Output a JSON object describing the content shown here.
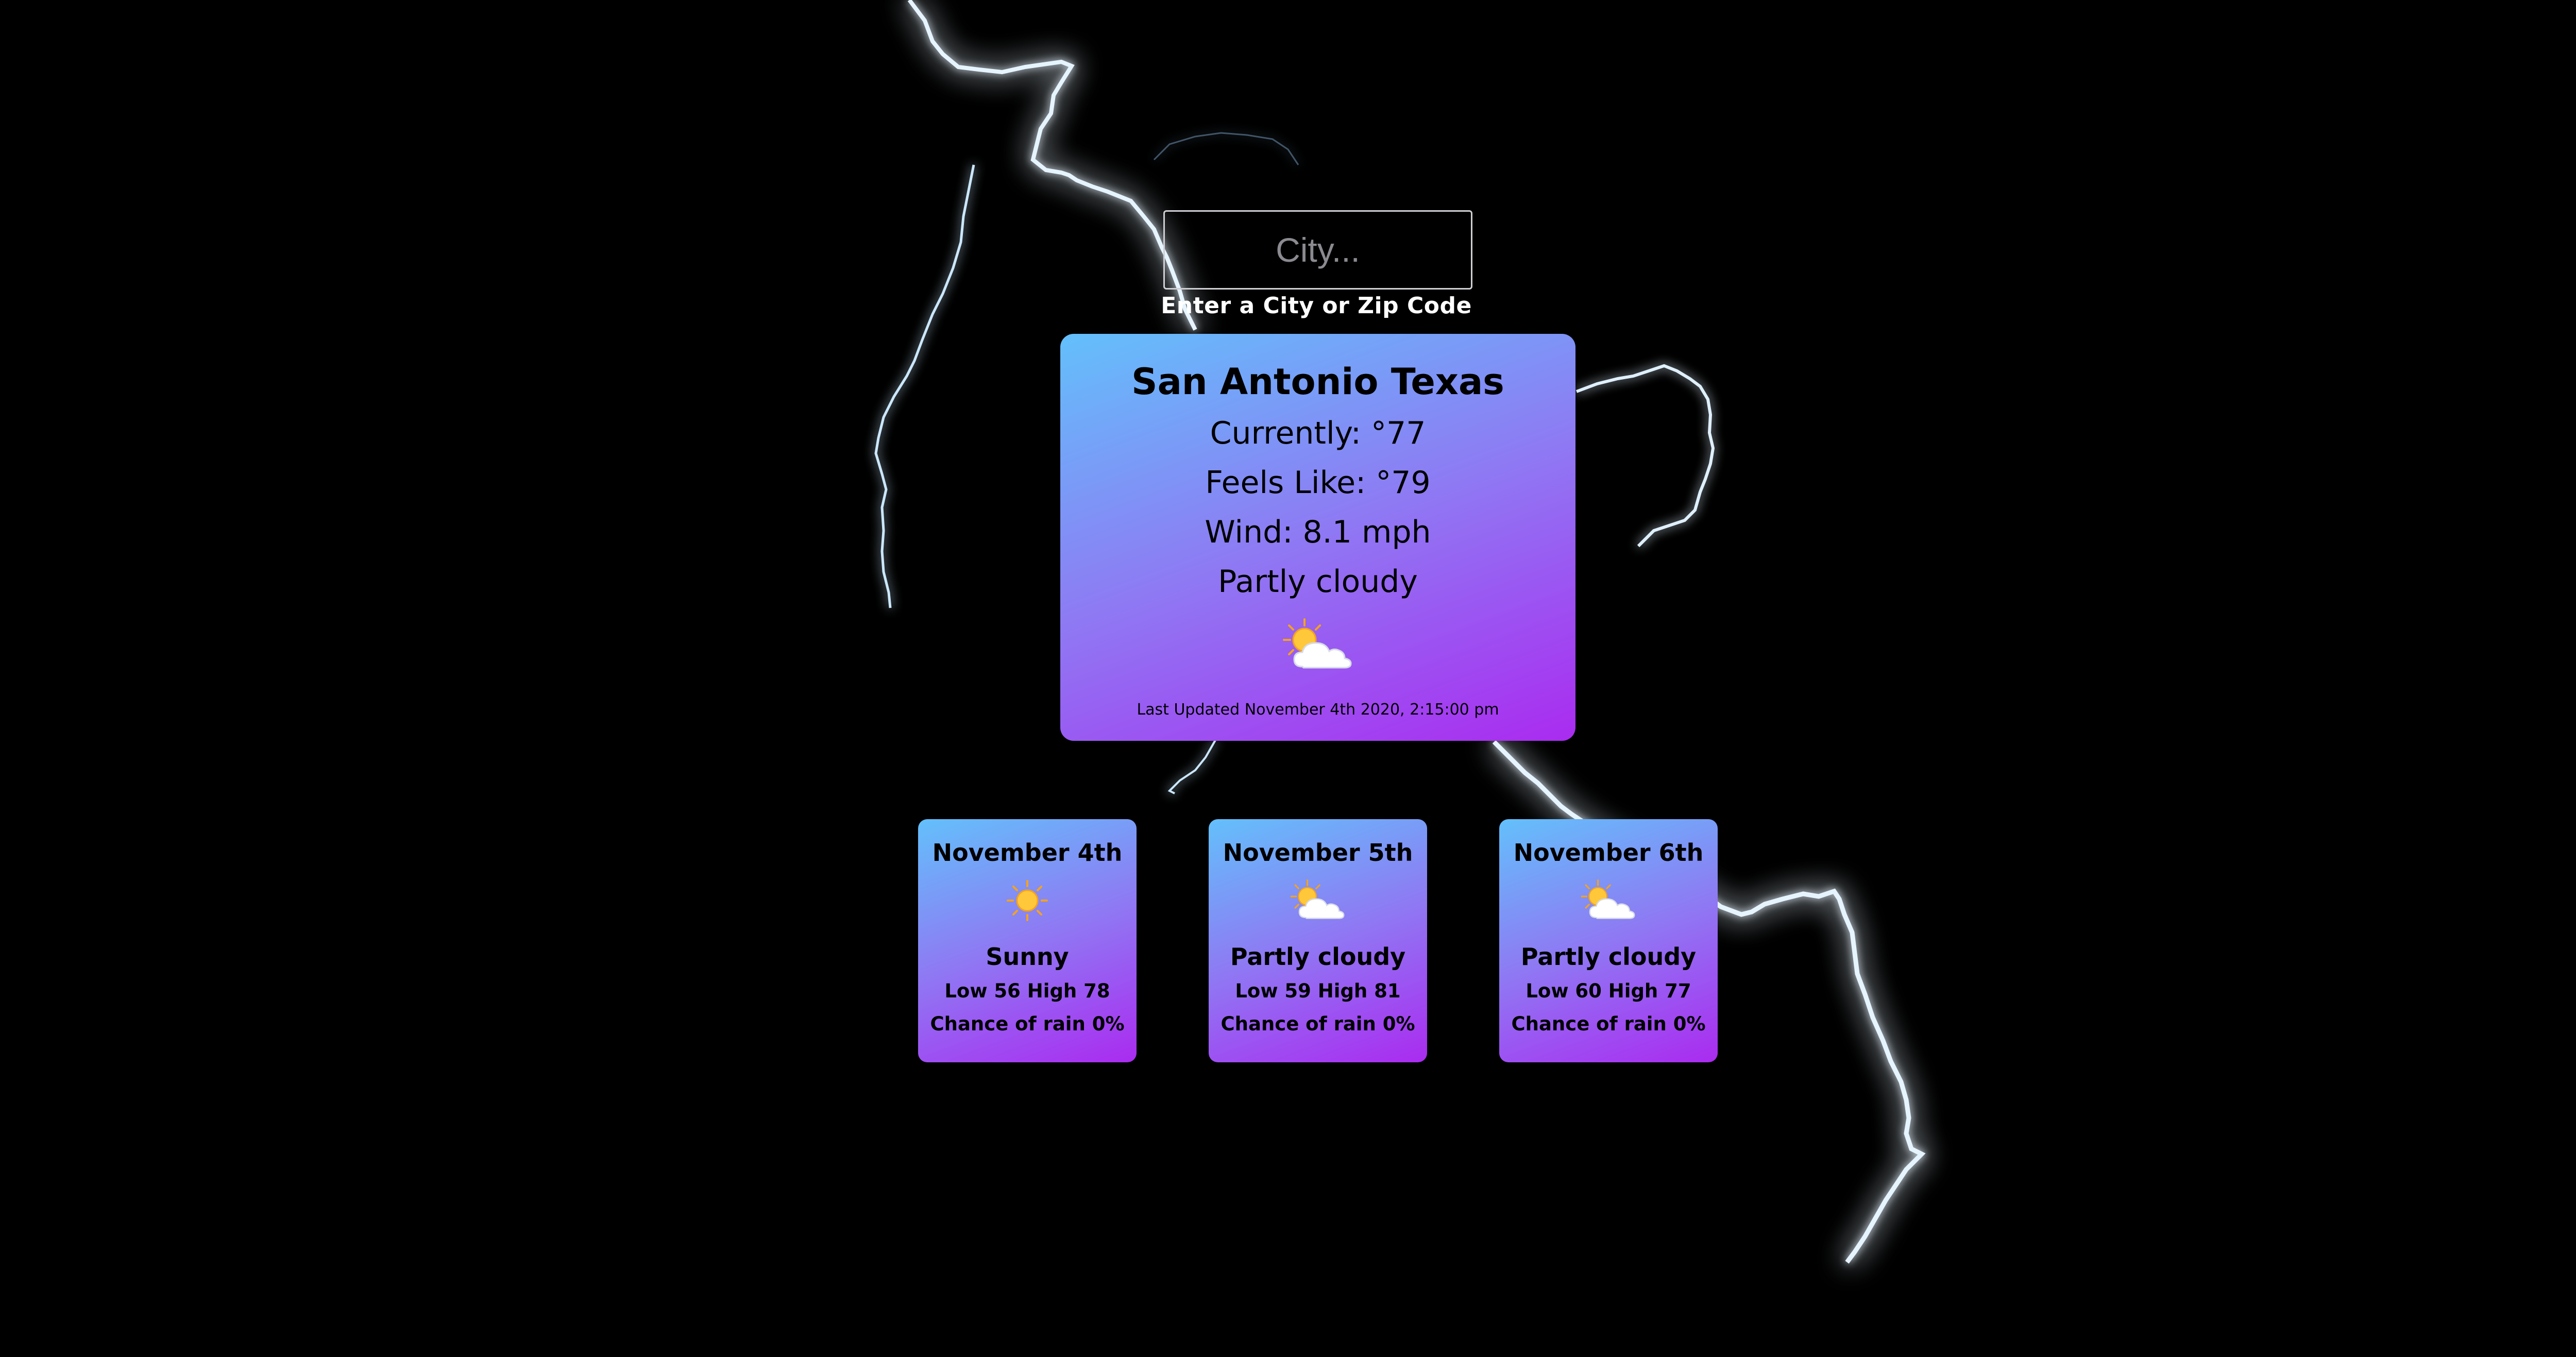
{
  "search": {
    "placeholder": "City...",
    "hint": "Enter a City or Zip Code"
  },
  "current": {
    "location": "San Antonio Texas",
    "currently": "Currently: °77",
    "feels_like": "Feels Like: °79",
    "wind": "Wind: 8.1 mph",
    "condition": "Partly cloudy",
    "icon": "partly-cloudy-icon",
    "last_updated": "Last Updated November 4th 2020, 2:15:00 pm"
  },
  "forecast": [
    {
      "date": "November 4th",
      "icon": "sun-icon",
      "condition": "Sunny",
      "temps": "Low 56 High 78",
      "rain": "Chance of rain 0%"
    },
    {
      "date": "November 5th",
      "icon": "partly-cloudy-icon",
      "condition": "Partly cloudy",
      "temps": "Low 59 High 81",
      "rain": "Chance of rain 0%"
    },
    {
      "date": "November 6th",
      "icon": "partly-cloudy-icon",
      "condition": "Partly cloudy",
      "temps": "Low 60 High 77",
      "rain": "Chance of rain 0%"
    }
  ],
  "colors": {
    "background": "#000000",
    "card_gradient_start": "#63c0fb",
    "card_gradient_end": "#aa2bf0",
    "lightning": "#9fd8ff"
  }
}
